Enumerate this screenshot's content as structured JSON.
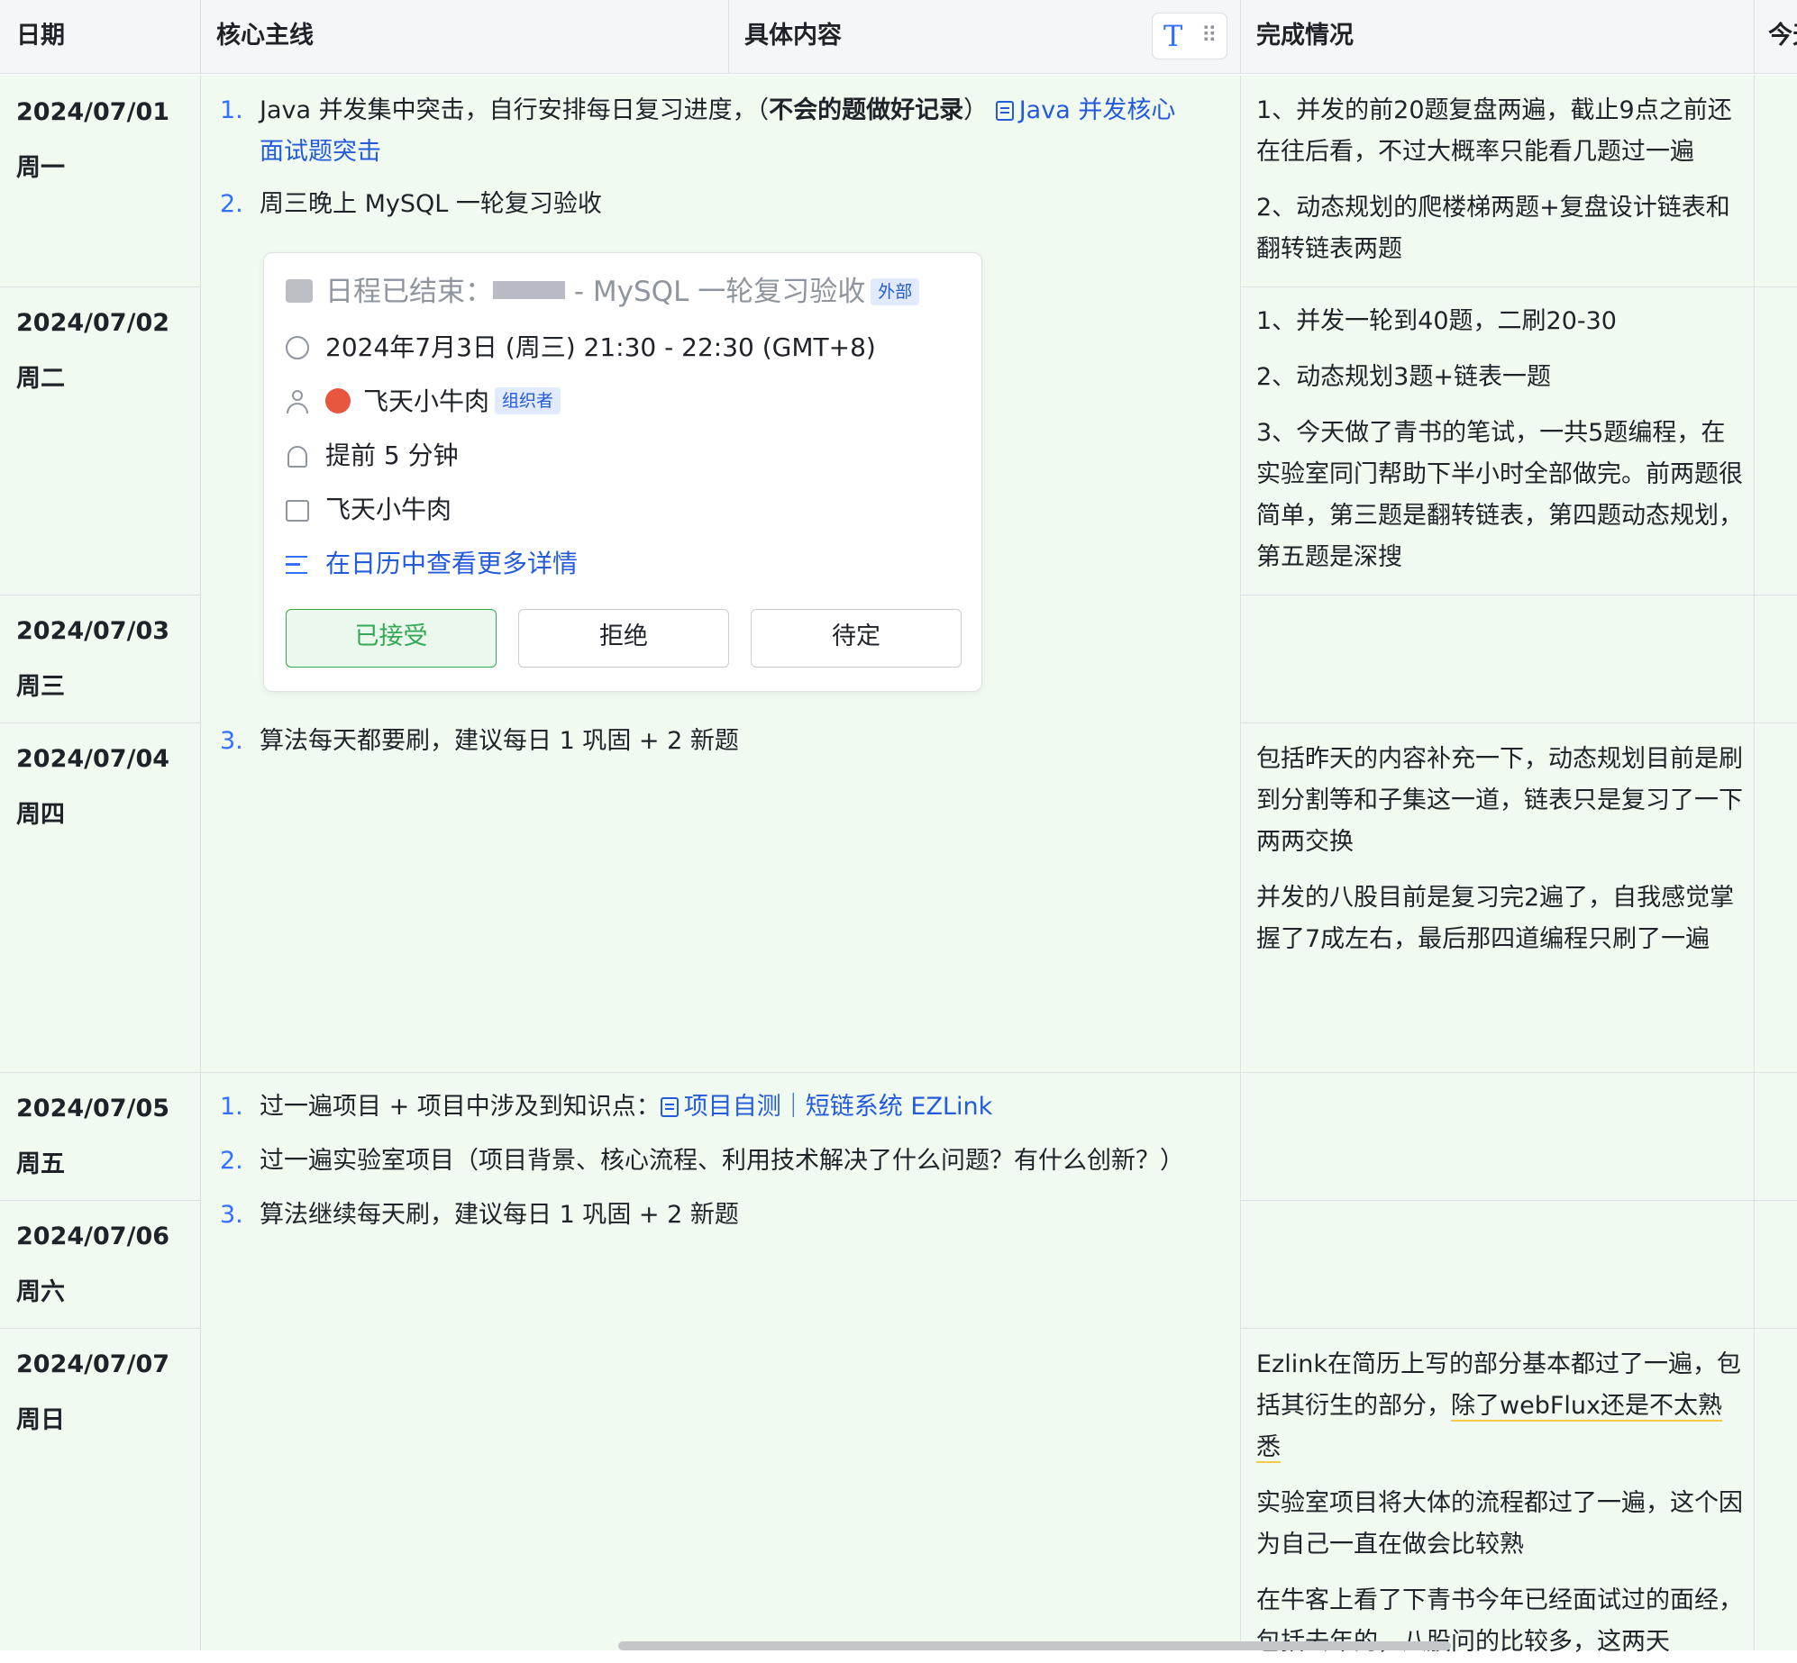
{
  "columns": {
    "date": "日期",
    "core": "核心主线",
    "detail": "具体内容",
    "done": "完成情况",
    "today": "今天"
  },
  "rows": [
    {
      "date": "2024/07/01",
      "weekday": "周一"
    },
    {
      "date": "2024/07/02",
      "weekday": "周二"
    },
    {
      "date": "2024/07/03",
      "weekday": "周三"
    },
    {
      "date": "2024/07/04",
      "weekday": "周四"
    },
    {
      "date": "2024/07/05",
      "weekday": "周五"
    },
    {
      "date": "2024/07/06",
      "weekday": "周六"
    },
    {
      "date": "2024/07/07",
      "weekday": "周日"
    }
  ],
  "plan1": {
    "item1_num": "1.",
    "item1_text": "Java 并发集中突击，自行安排每日复习进度，（",
    "item1_bold": "不会的题做好记录",
    "item1_tail": "）",
    "item1_link_a": "Java 并发核心",
    "item1_link_b": "面试题突击",
    "item2_num": "2.",
    "item2_text": "周三晚上 MySQL 一轮复习验收",
    "item3_num": "3.",
    "item3_text": "算法每天都要刷，建议每日 1 巩固 + 2 新题"
  },
  "event": {
    "title_prefix": "日程已结束：",
    "title_suffix": " - MySQL 一轮复习验收",
    "external_tag": "外部",
    "time": "2024年7月3日 (周三) 21:30 - 22:30 (GMT+8)",
    "organizer": "飞天小牛肉",
    "organizer_tag": "组织者",
    "reminder": "提前 5 分钟",
    "calendar": "飞天小牛肉",
    "details_link": "在日历中查看更多详情",
    "accept": "已接受",
    "decline": "拒绝",
    "tentative": "待定"
  },
  "plan2": {
    "item1_num": "1.",
    "item1_text": "过一遍项目 + 项目中涉及到知识点：",
    "item1_link": "项目自测｜短链系统 EZLink",
    "item2_num": "2.",
    "item2_text": "过一遍实验室项目（项目背景、核心流程、利用技术解决了什么问题？有什么创新？）",
    "item3_num": "3.",
    "item3_text": "算法继续每天刷，建议每日 1 巩固 + 2 新题"
  },
  "done": {
    "d1_p1": "1、并发的前20题复盘两遍，截止9点之前还在往后看，不过大概率只能看几题过一遍",
    "d1_p2": "2、动态规划的爬楼梯两题+复盘设计链表和翻转链表两题",
    "d2_p1": "1、并发一轮到40题，二刷20-30",
    "d2_p2": "2、动态规划3题+链表一题",
    "d2_p3": "3、今天做了青书的笔试，一共5题编程，在实验室同门帮助下半小时全部做完。前两题很简单，第三题是翻转链表，第四题动态规划，第五题是深搜",
    "d4_p1": "包括昨天的内容补充一下，动态规划目前是刷到分割等和子集这一道，链表只是复习了一下两两交换",
    "d4_p2": "并发的八股目前是复习完2遍了，自我感觉掌握了7成左右，最后那四道编程只刷了一遍",
    "d7_p1a": "Ezlink在简历上写的部分基本都过了一遍，包括其衍生的部分，",
    "d7_p1b": "除了webFlux还是不太熟悉",
    "d7_p2": "实验室项目将大体的流程都过了一遍，这个因为自己一直在做会比较熟",
    "d7_p3": "在牛客上看了下青书今年已经面试过的面经，包括去年的，八股问的比较多，这两天"
  },
  "colors": {
    "accent": "#3370ff",
    "row_bg": "#f0faf0",
    "accept": "#34a853",
    "tag_bg": "#e1eaff"
  }
}
